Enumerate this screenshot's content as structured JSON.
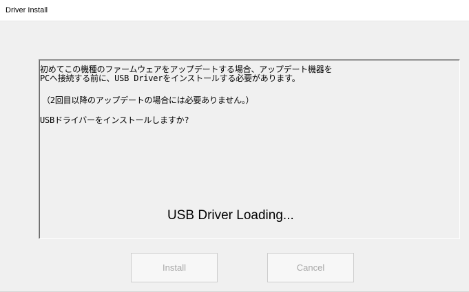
{
  "window": {
    "title": "Driver Install"
  },
  "message": {
    "line1": "初めてこの機種のファームウェアをアップデートする場合、アップデート機器を",
    "line2": "PCへ接続する前に、USB Driverをインストールする必要があります。",
    "line3": "（2回目以降のアップデートの場合には必要ありません。）",
    "line4": "USBドライバーをインストールしますか?"
  },
  "status": {
    "loading_text": "USB Driver Loading..."
  },
  "buttons": {
    "install_label": "Install",
    "cancel_label": "Cancel"
  },
  "colors": {
    "window_bg": "#f0f0f0",
    "titlebar_bg": "#ffffff",
    "disabled_text": "#a8a8a8"
  }
}
